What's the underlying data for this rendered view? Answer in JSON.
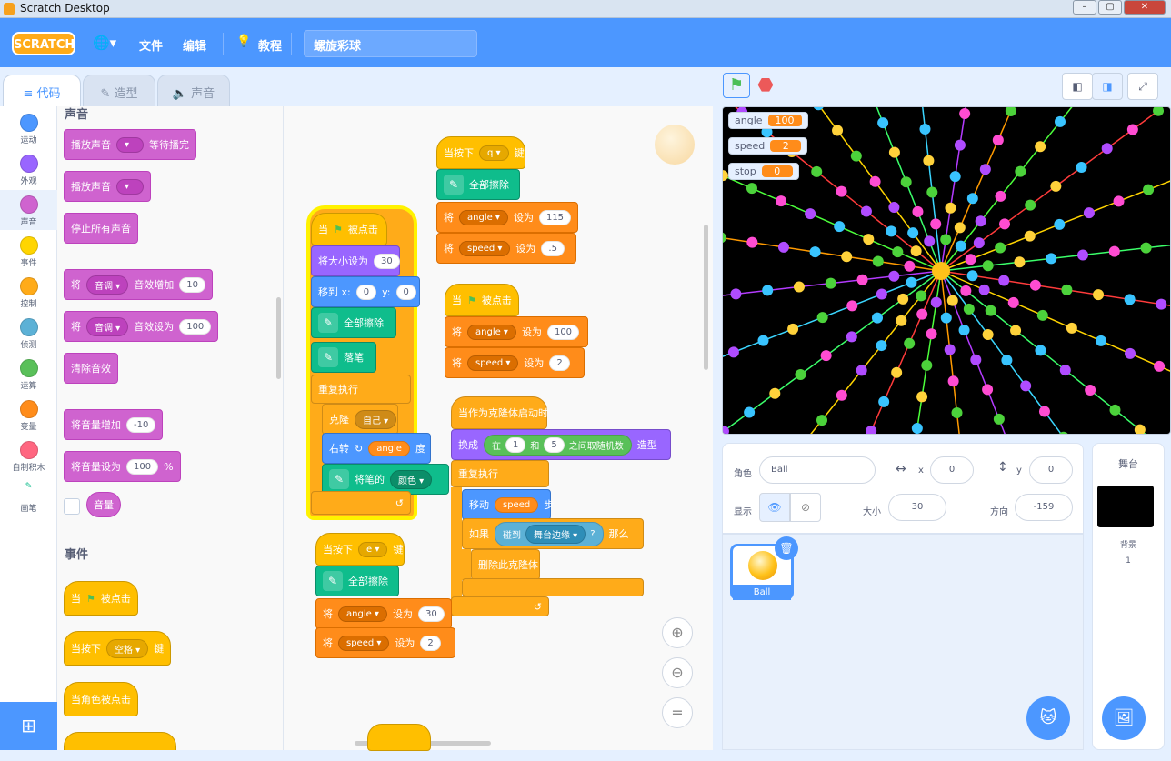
{
  "window": {
    "title": "Scratch Desktop",
    "min": "–",
    "max": "▢",
    "close": "✕"
  },
  "menubar": {
    "logo": "SCRATCH",
    "globe": "🌐▾",
    "file": "文件",
    "edit": "编辑",
    "tutorial_icon": "💡",
    "tutorials": "教程",
    "project_name": "螺旋彩球"
  },
  "tabs": [
    {
      "label": "代码",
      "icon": "≡"
    },
    {
      "label": "造型",
      "icon": "✎"
    },
    {
      "label": "声音",
      "icon": "🔈"
    }
  ],
  "categories": [
    {
      "label": "运动",
      "color": "#4c97ff"
    },
    {
      "label": "外观",
      "color": "#9966ff"
    },
    {
      "label": "声音",
      "color": "#cf63cf"
    },
    {
      "label": "事件",
      "color": "#ffd500"
    },
    {
      "label": "控制",
      "color": "#ffab19"
    },
    {
      "label": "侦测",
      "color": "#5cb1d6"
    },
    {
      "label": "运算",
      "color": "#59c059"
    },
    {
      "label": "变量",
      "color": "#ff8c1a"
    },
    {
      "label": "自制积木",
      "color": "#ff6680"
    },
    {
      "label": "画笔",
      "color": "#0fbd8c"
    }
  ],
  "extension_icon": "⊞",
  "palette": {
    "sound_head": "声音",
    "play_until_done": "播放声音",
    "play_until_done_suffix": "等待播完",
    "play": "播放声音",
    "stop_all": "停止所有声音",
    "change_effect": "将",
    "effect_pitch": "音调",
    "effect_change_suffix": "音效增加",
    "effect_change_val": "10",
    "set_effect": "将",
    "effect_set_suffix": "音效设为",
    "effect_set_val": "100",
    "clear_effects": "清除音效",
    "change_vol": "将音量增加",
    "change_vol_val": "-10",
    "set_vol": "将音量设为",
    "set_vol_val": "100",
    "set_vol_pct": "%",
    "volume": "音量",
    "events_head": "事件",
    "when_flag": "当",
    "when_flag_suffix": "被点击",
    "when_key": "当按下",
    "key_space": "空格",
    "key_suffix": "键",
    "when_sprite_clicked": "当角色被点击"
  },
  "script1": {
    "hat": "当",
    "hat_suffix": "被点击",
    "size": "将大小设为",
    "size_val": "30",
    "goto": "移到 x:",
    "x_val": "0",
    "y_lbl": "y:",
    "y_val": "0",
    "clear": "全部擦除",
    "pendown": "落笔",
    "forever": "重复执行",
    "clone": "克隆",
    "clone_target": "自己",
    "turn": "右转",
    "turn_icon": "↻",
    "turn_var": "angle",
    "turn_unit": "度",
    "pen_color": "将笔的",
    "pen_color_param": "颜色",
    "loop_arrow": "↺"
  },
  "script2": {
    "hat": "当按下",
    "key": "q",
    "key_suffix": "键",
    "clear": "全部擦除",
    "set1": "将",
    "var1": "angle",
    "set_word": "设为",
    "val1": "115",
    "var2": "speed",
    "val2": ".5"
  },
  "script3": {
    "hat": "当",
    "hat_suffix": "被点击",
    "set1": "将",
    "var1": "angle",
    "set_word": "设为",
    "val1": "100",
    "var2": "speed",
    "val2": "2"
  },
  "script4": {
    "hat": "当作为克隆体启动时",
    "costume": "换成",
    "in": "在",
    "a": "1",
    "and": "和",
    "b": "5",
    "between": "之间取随机数",
    "costume_suffix": "造型",
    "forever": "重复执行",
    "move": "移动",
    "move_var": "speed",
    "move_unit": "步",
    "if": "如果",
    "touch": "碰到",
    "edge": "舞台边缘",
    "q": "?",
    "then": "那么",
    "delete": "删除此克隆体",
    "loop_arrow": "↺"
  },
  "script5": {
    "hat": "当按下",
    "key": "e",
    "key_suffix": "键",
    "clear": "全部擦除",
    "set1": "将",
    "var1": "angle",
    "set_word": "设为",
    "val1": "30",
    "var2": "speed",
    "val2": "2"
  },
  "zoom": {
    "in": "⊕",
    "out": "⊖",
    "reset": "="
  },
  "stage_controls": {
    "flag": "⚑",
    "stop": "⬣",
    "small": "◧",
    "large": "◨",
    "full": "⤢"
  },
  "monitors": [
    {
      "name": "angle",
      "value": "100"
    },
    {
      "name": "speed",
      "value": "2"
    },
    {
      "name": "stop",
      "value": "0"
    }
  ],
  "sprite_info": {
    "sprite_label": "角色",
    "sprite_name": "Ball",
    "x_icon": "↔",
    "x_label": "x",
    "x": "0",
    "y_icon": "↕",
    "y_label": "y",
    "y": "0",
    "show_label": "显示",
    "show_icon": "👁",
    "hide_icon": "⊘",
    "size_label": "大小",
    "size": "30",
    "dir_label": "方向",
    "dir": "-159"
  },
  "sprites": [
    {
      "name": "Ball",
      "delete_icon": "🗑"
    }
  ],
  "stage_panel": {
    "title": "舞台",
    "backdrops_label": "背景",
    "backdrops_count": "1"
  },
  "add_sprite_icon": "🐱",
  "add_backdrop_icon": "🖼"
}
